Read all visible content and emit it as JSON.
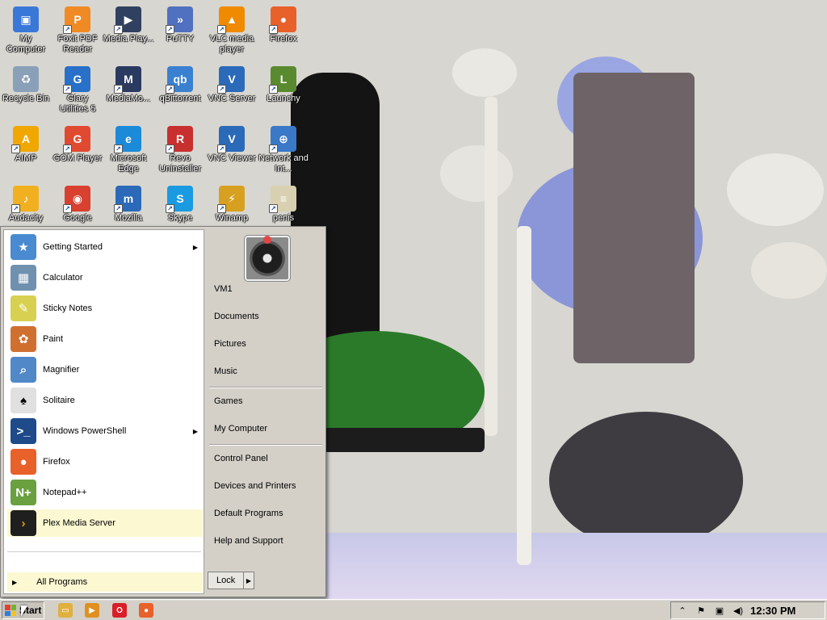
{
  "desktop": {
    "icons": [
      {
        "label": "My Computer",
        "icon": "computer-icon",
        "color": "#3a78d8"
      },
      {
        "label": "Foxit PDF Reader",
        "icon": "pdf-icon",
        "color": "#f08a24"
      },
      {
        "label": "Media Play...",
        "icon": "media-player-icon",
        "color": "#304060"
      },
      {
        "label": "PuTTY",
        "icon": "terminal-icon",
        "color": "#5070c0"
      },
      {
        "label": "VLC media player",
        "icon": "vlc-icon",
        "color": "#f08a00"
      },
      {
        "label": "Firefox",
        "icon": "firefox-icon",
        "color": "#e8602a"
      },
      {
        "label": "Recycle Bin",
        "icon": "recycle-bin-icon",
        "color": "#8aa0b8"
      },
      {
        "label": "Glary Utilities 5",
        "icon": "glary-icon",
        "color": "#2870c8"
      },
      {
        "label": "MediaMo...",
        "icon": "mediamonkey-icon",
        "color": "#2a3a60"
      },
      {
        "label": "qBittorrent",
        "icon": "qbittorrent-icon",
        "color": "#3a80d0"
      },
      {
        "label": "VNC Server",
        "icon": "vnc-icon",
        "color": "#2a6ab8"
      },
      {
        "label": "Launchy",
        "icon": "launchy-icon",
        "color": "#5a8a30"
      },
      {
        "label": "AIMP",
        "icon": "aimp-icon",
        "color": "#f0a800"
      },
      {
        "label": "GOM Player",
        "icon": "gom-player-icon",
        "color": "#e04a30"
      },
      {
        "label": "Microsoft Edge",
        "icon": "edge-icon",
        "color": "#1b8ad8"
      },
      {
        "label": "Revo Uninstaller",
        "icon": "revo-icon",
        "color": "#c83030"
      },
      {
        "label": "VNC Viewer",
        "icon": "vnc-icon",
        "color": "#2a6ab8"
      },
      {
        "label": "Network and Int...",
        "icon": "network-icon",
        "color": "#3a78c8"
      },
      {
        "label": "Audacity",
        "icon": "audacity-icon",
        "color": "#f0b020"
      },
      {
        "label": "Google",
        "icon": "chrome-icon",
        "color": "#d84030"
      },
      {
        "label": "Mozilla",
        "icon": "mozilla-icon",
        "color": "#2a6ab8"
      },
      {
        "label": "Skype",
        "icon": "skype-icon",
        "color": "#1a9ae0"
      },
      {
        "label": "Winamp",
        "icon": "winamp-icon",
        "color": "#d8a020"
      },
      {
        "label": "penis",
        "icon": "certificate-icon",
        "color": "#d8d0b0"
      }
    ]
  },
  "start_menu": {
    "programs": [
      {
        "label": "Getting Started",
        "icon": "getting-started-icon",
        "color": "#4a8ad0",
        "submenu": true
      },
      {
        "label": "Calculator",
        "icon": "calculator-icon",
        "color": "#7090b0",
        "submenu": false
      },
      {
        "label": "Sticky Notes",
        "icon": "sticky-notes-icon",
        "color": "#d8d050",
        "submenu": false
      },
      {
        "label": "Paint",
        "icon": "paint-icon",
        "color": "#d07030",
        "submenu": false
      },
      {
        "label": "Magnifier",
        "icon": "magnifier-icon",
        "color": "#5088c8",
        "submenu": false
      },
      {
        "label": "Solitaire",
        "icon": "solitaire-icon",
        "color": "#e0e0e0",
        "submenu": false
      },
      {
        "label": "Windows PowerShell",
        "icon": "powershell-icon",
        "color": "#1e4a8a",
        "submenu": true
      },
      {
        "label": "Firefox",
        "icon": "firefox-icon",
        "color": "#e8602a",
        "submenu": false
      },
      {
        "label": "Notepad++",
        "icon": "notepad-plus-icon",
        "color": "#6aa040",
        "submenu": false
      },
      {
        "label": "Plex Media Server",
        "icon": "plex-icon",
        "color": "#1f1f1f",
        "submenu": false,
        "highlighted": true
      }
    ],
    "all_programs": "All Programs",
    "places": [
      {
        "label": "VM1",
        "group": 0
      },
      {
        "label": "Documents",
        "group": 0
      },
      {
        "label": "Pictures",
        "group": 0
      },
      {
        "label": "Music",
        "group": 0
      },
      {
        "label": "Games",
        "group": 1
      },
      {
        "label": "My Computer",
        "group": 1
      },
      {
        "label": "Control Panel",
        "group": 2
      },
      {
        "label": "Devices and Printers",
        "group": 2
      },
      {
        "label": "Default Programs",
        "group": 2
      },
      {
        "label": "Help and Support",
        "group": 2
      }
    ],
    "lock_label": "Lock"
  },
  "taskbar": {
    "start_label": "Start",
    "quick_launch": [
      {
        "icon": "explorer-icon",
        "color": "#e0b040"
      },
      {
        "icon": "media-player-icon",
        "color": "#e09020"
      },
      {
        "icon": "opera-icon",
        "color": "#d81e28"
      },
      {
        "icon": "firefox-icon",
        "color": "#e8602a"
      }
    ],
    "tray_icons": [
      "chevron-up-icon",
      "flag-icon",
      "network-icon",
      "volume-icon"
    ],
    "clock": "12:30 PM"
  }
}
